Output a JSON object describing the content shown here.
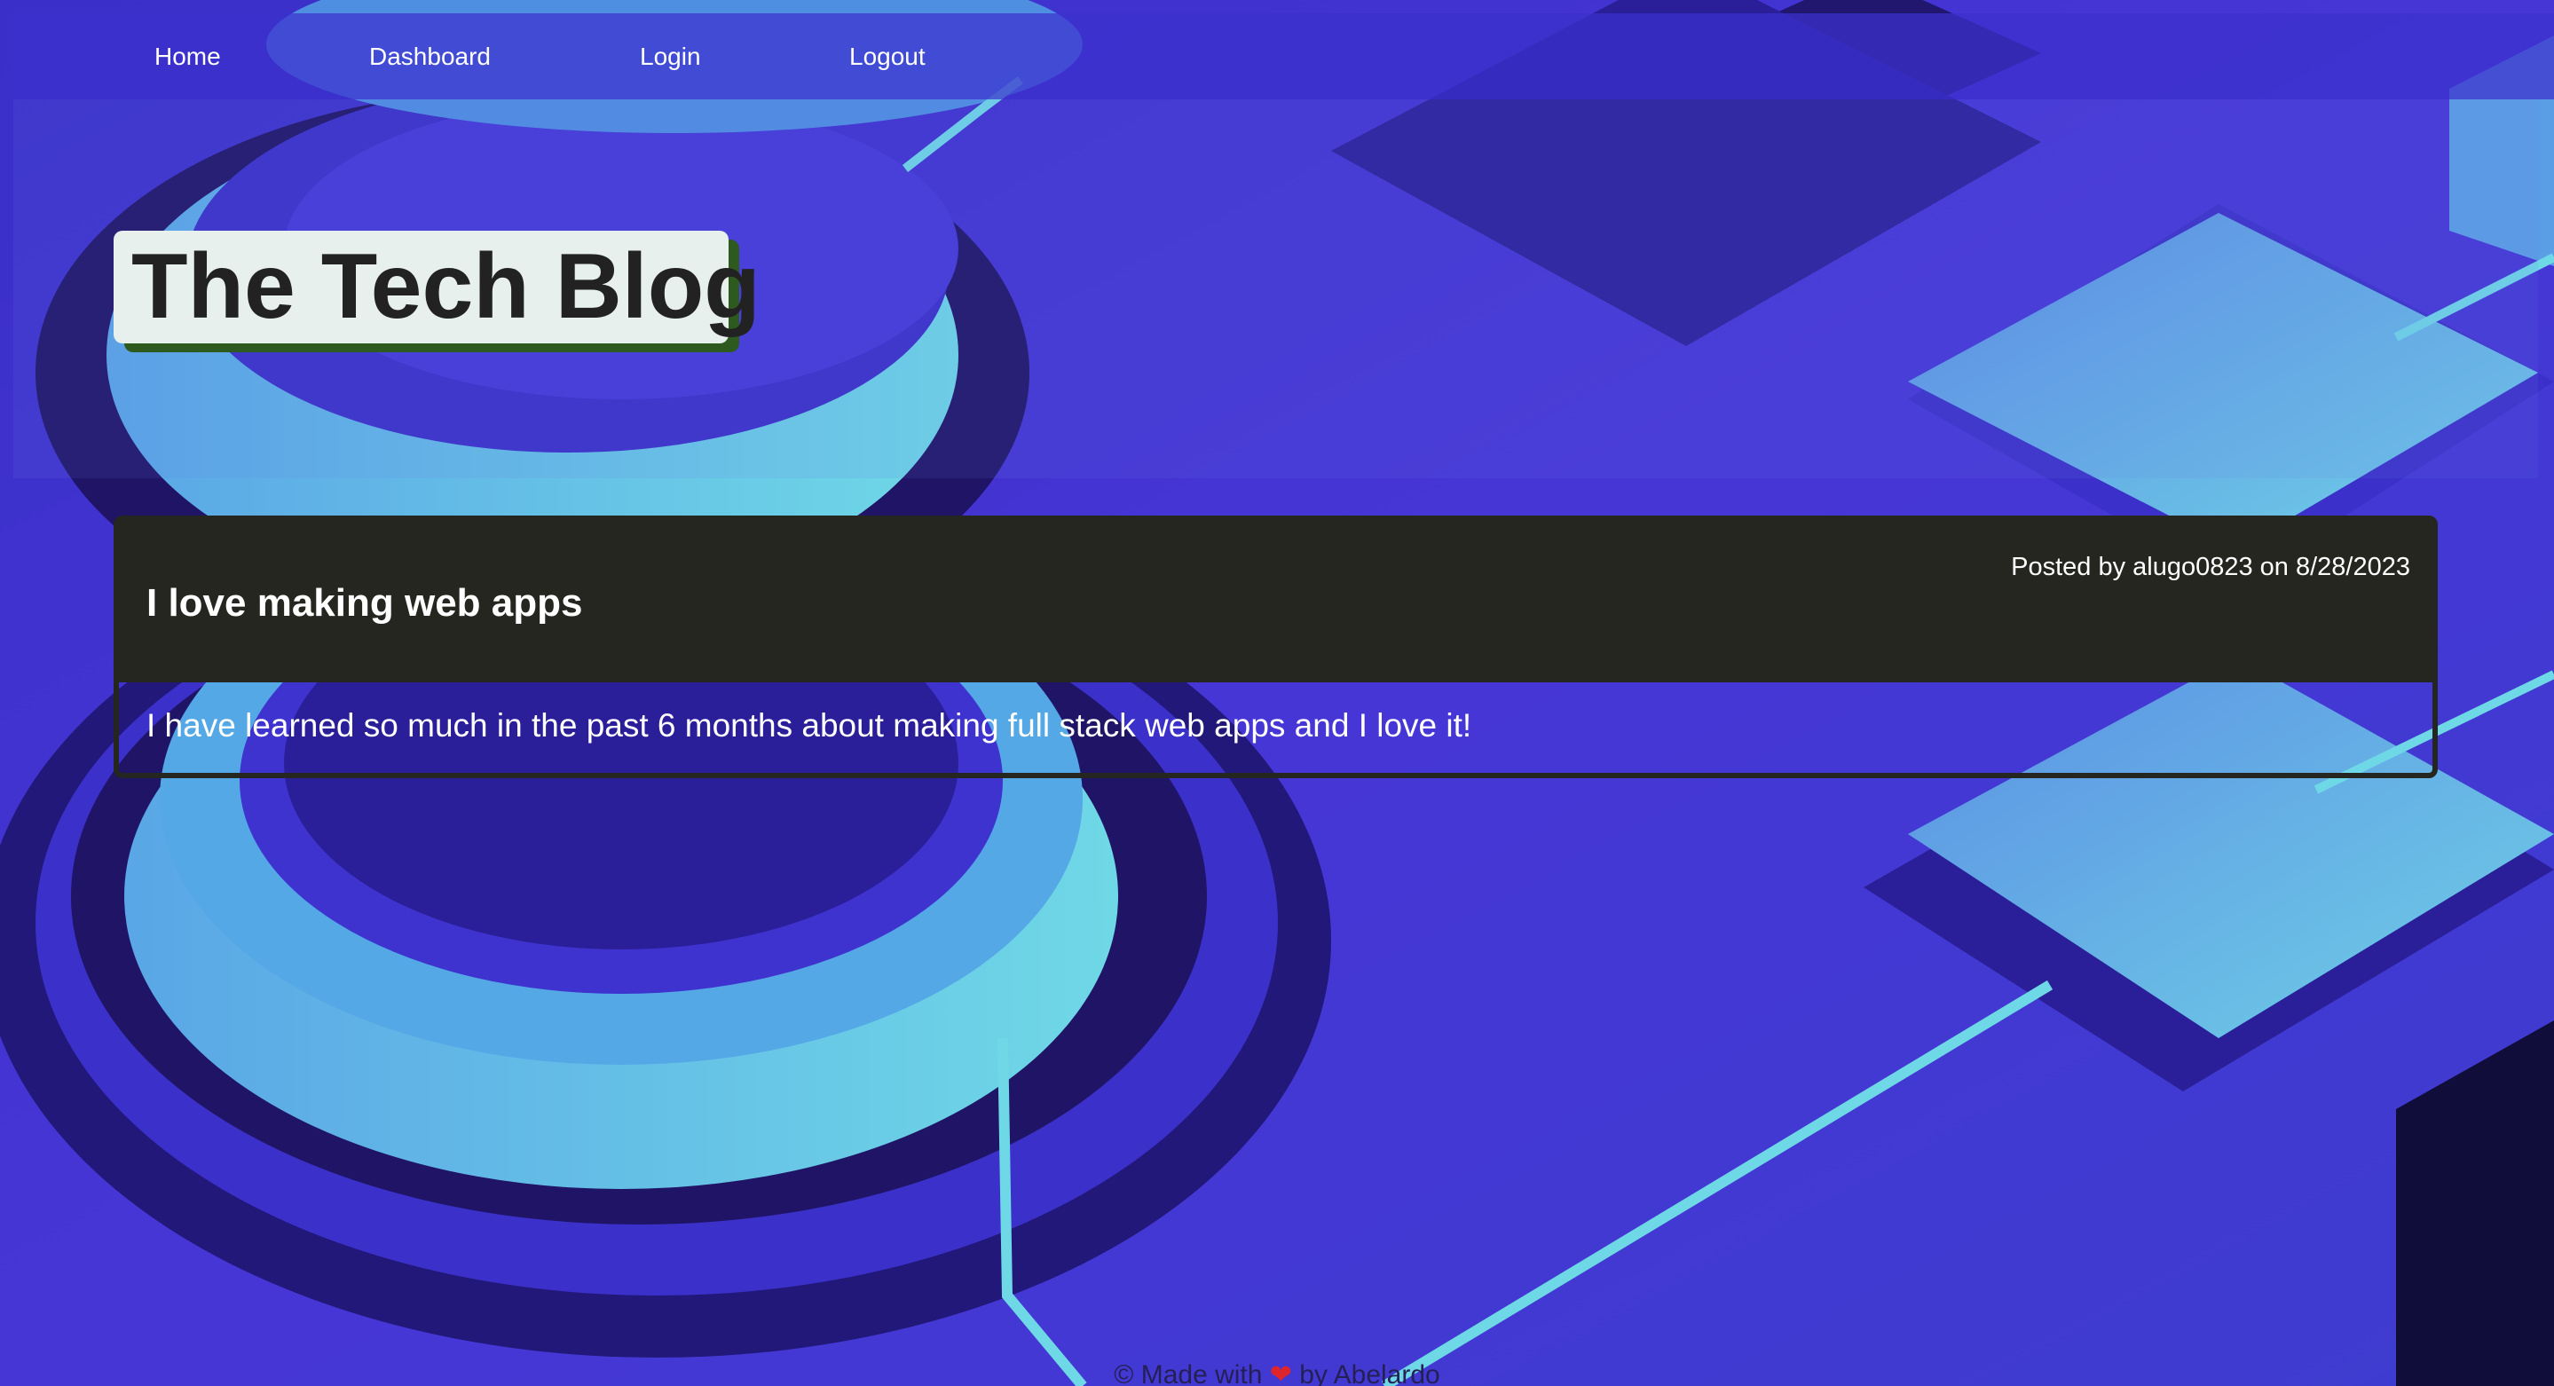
{
  "nav": {
    "items": [
      {
        "label": "Home"
      },
      {
        "label": "Dashboard"
      },
      {
        "label": "Login"
      },
      {
        "label": "Logout"
      }
    ]
  },
  "header": {
    "title": "The Tech Blog"
  },
  "post": {
    "title": "I love making web apps",
    "meta": "Posted by alugo0823 on 8/28/2023",
    "body": "I have learned so much in the past 6 months about making full stack web apps and I love it!"
  },
  "footer": {
    "prefix": "© Made with",
    "heart_icon": "heart-icon",
    "suffix": "by Abelardo"
  },
  "colors": {
    "background": "#3b2fc4",
    "card_header": "#25261f",
    "title_box": "#e7f0ec",
    "title_shadow": "#2e5a1f",
    "accent_cyan": "#6fd8e6"
  }
}
